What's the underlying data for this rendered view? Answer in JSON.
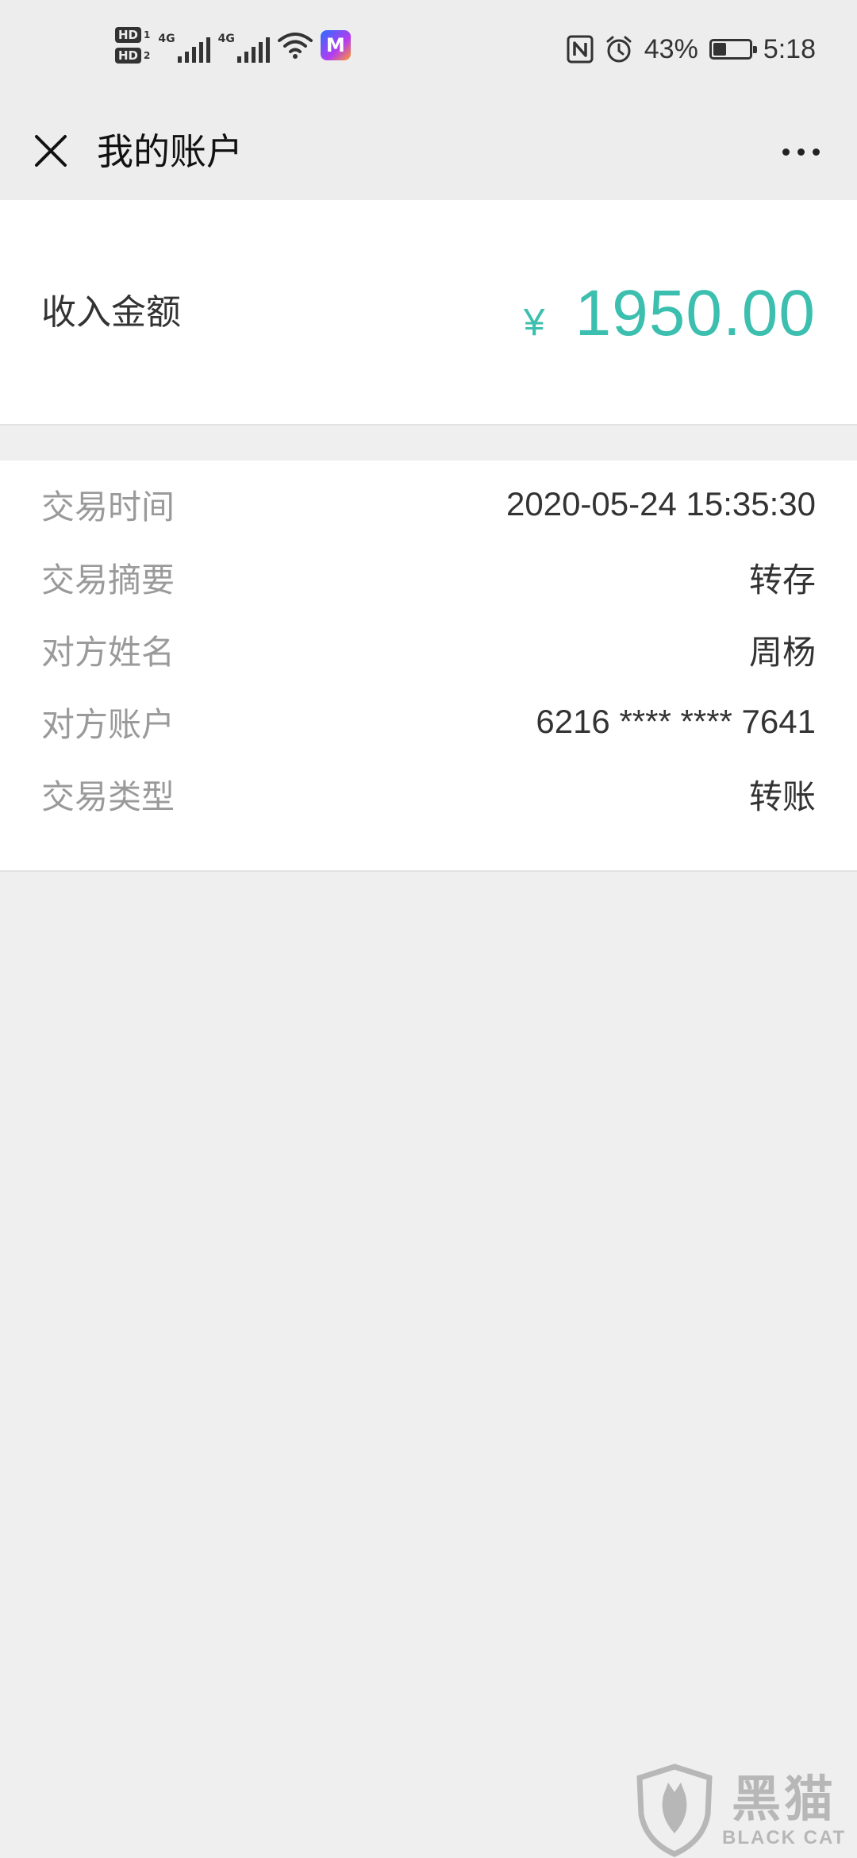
{
  "status_bar": {
    "hd1_label": "HD",
    "hd1_num": "1",
    "hd2_label": "HD",
    "hd2_num": "2",
    "net1_label": "4G",
    "net2_label": "4G",
    "app_icon_letter": "M",
    "battery_percent": "43%",
    "battery_level": 0.43,
    "time": "5:18"
  },
  "nav": {
    "title": "我的账户"
  },
  "amount": {
    "label": "收入金额",
    "currency": "¥",
    "value": "1950.00",
    "color": "#3cbfae"
  },
  "details": [
    {
      "key": "交易时间",
      "value": "2020-05-24 15:35:30"
    },
    {
      "key": "交易摘要",
      "value": "转存"
    },
    {
      "key": "对方姓名",
      "value": "周杨"
    },
    {
      "key": "对方账户",
      "value": "6216 **** **** 7641"
    },
    {
      "key": "交易类型",
      "value": "转账"
    }
  ],
  "watermark": {
    "cn": "黑猫",
    "en": "BLACK CAT"
  }
}
